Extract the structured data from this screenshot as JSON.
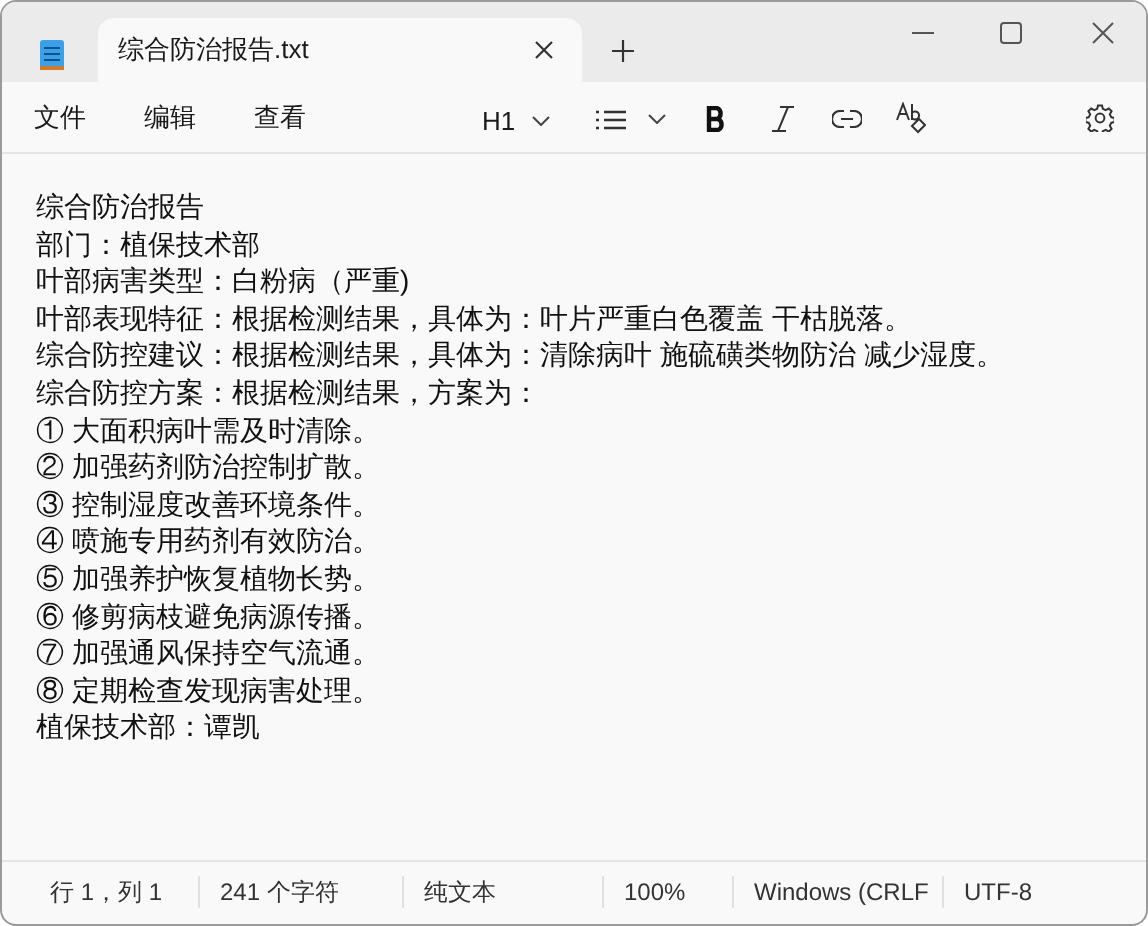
{
  "tab": {
    "title": "综合防治报告.txt",
    "selected": true
  },
  "menu": [
    "文件",
    "编辑",
    "查看"
  ],
  "toolbar": {
    "heading": "H1"
  },
  "document": {
    "lines": [
      "综合防治报告",
      "部门：植保技术部",
      "叶部病害类型：白粉病（严重)",
      "叶部表现特征：根据检测结果，具体为：叶片严重白色覆盖 干枯脱落。",
      "综合防控建议：根据检测结果，具体为：清除病叶 施硫磺类物防治 减少湿度。",
      "综合防控方案：根据检测结果，方案为：",
      "① 大面积病叶需及时清除。",
      "② 加强药剂防治控制扩散。",
      "③ 控制湿度改善环境条件。",
      "④ 喷施专用药剂有效防治。",
      "⑤ 加强养护恢复植物长势。",
      "⑥ 修剪病枝避免病源传播。",
      "⑦ 加强通风保持空气流通。",
      "⑧ 定期检查发现病害处理。",
      "植保技术部：谭凯"
    ]
  },
  "status_bar": [
    "行 1，列 1",
    "241 个字符",
    "纯文本",
    "100%",
    "Windows (CRLF",
    "UTF-8"
  ]
}
